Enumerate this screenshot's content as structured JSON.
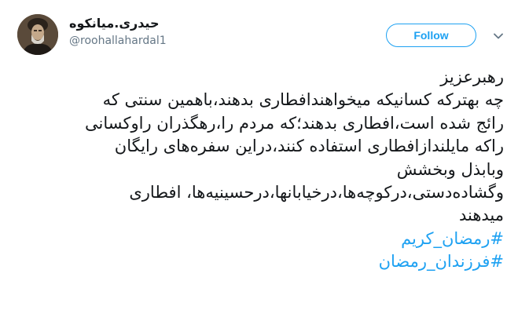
{
  "author": {
    "display_name": "حیدری.میانکوه",
    "handle": "@roohallahardal1"
  },
  "actions": {
    "follow_label": "Follow",
    "menu_icon": "chevron-down-icon",
    "accent_color": "#1da1f2"
  },
  "tweet": {
    "lines": [
      "رهبرعزیز",
      "چه بهترکه کسانیکه میخواهندافطاری بدهند،باهمین سنتی که",
      "رائج شده است،افطاری بدهند؛که مردم را،رهگذران راوکسانی",
      "راکه مایلندازافطاری استفاده کنند،دراین سفره‌های رایگان",
      "وبابذل وبخشش",
      "وگشاده‌دستی،درکوچه‌ها،درخیابانها،درحسینیه‌ها، افطاری",
      "میدهند"
    ],
    "hashtags": [
      "#رمضان_کریم",
      "#فرزندان_رمضان"
    ]
  }
}
